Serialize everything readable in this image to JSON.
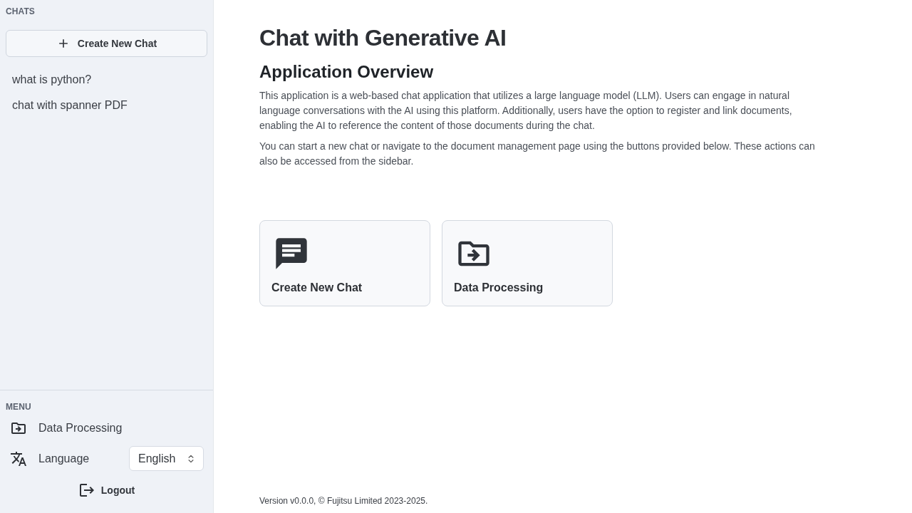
{
  "sidebar": {
    "chats_heading": "CHATS",
    "new_chat_button": "Create New Chat",
    "chats": [
      {
        "title": "what is python?",
        "selected": false
      },
      {
        "title": "chat with spanner PDF",
        "selected": false
      }
    ],
    "menu_heading": "MENU",
    "menu_items": [
      {
        "kind": "link",
        "label": "Data Processing"
      },
      {
        "kind": "select",
        "label": "Language",
        "value": "English"
      }
    ],
    "logout_button": "Logout"
  },
  "main": {
    "title": "Chat with Generative AI",
    "section_title": "Application Overview",
    "paragraphs": [
      "This application is a web-based chat application that utilizes a large language model (LLM). Users can engage in natural language conversations with the AI using this platform. Additionally, users have the option to register and link documents, enabling the AI to reference the content of those documents during the chat.",
      "You can start a new chat or navigate to the document management page using the buttons provided below. These actions can also be accessed from the sidebar."
    ],
    "cards": [
      {
        "kind": "chat",
        "label": "Create New Chat"
      },
      {
        "kind": "data",
        "label": "Data Processing"
      }
    ]
  },
  "footer": "Version v0.0.0, © Fujitsu Limited 2023-2025."
}
